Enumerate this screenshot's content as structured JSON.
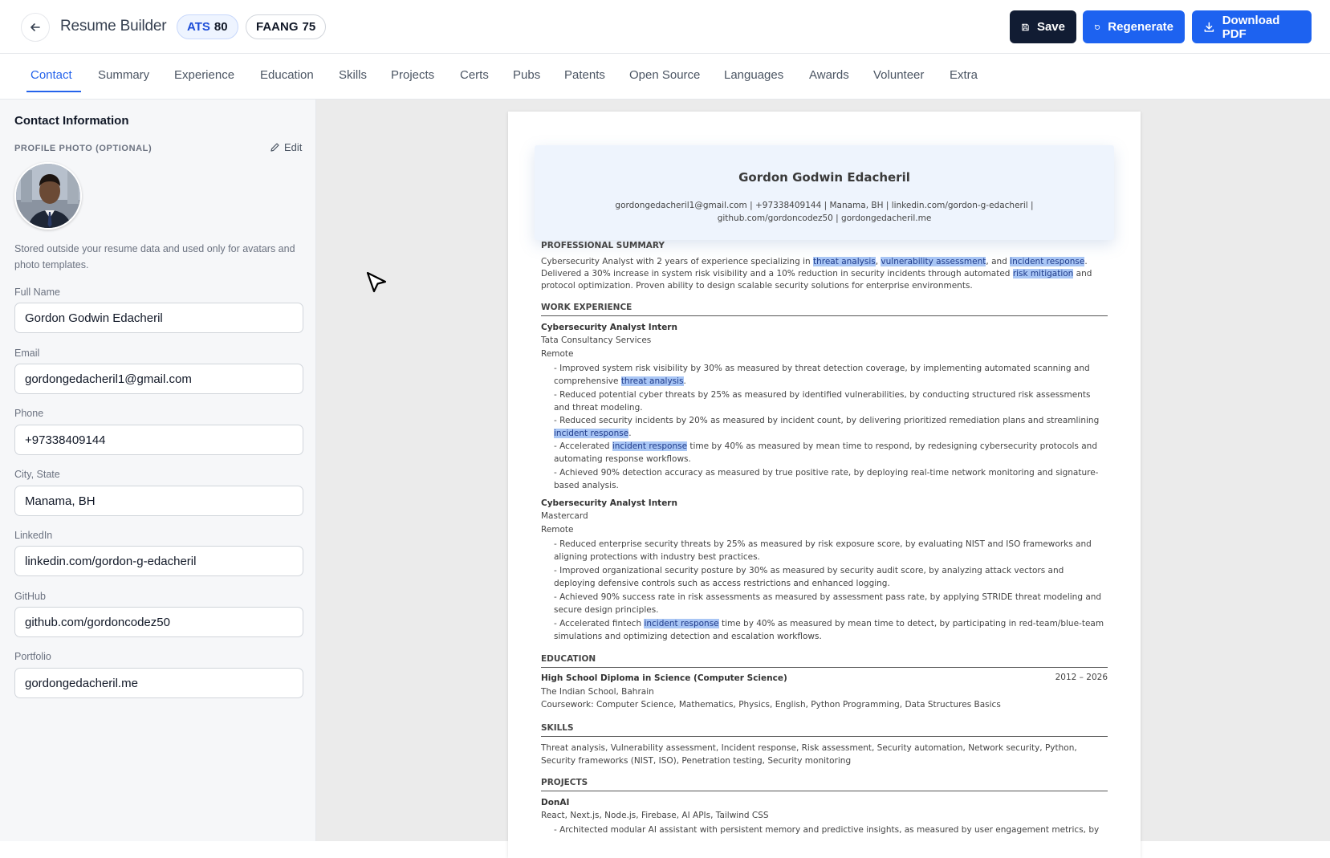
{
  "header": {
    "title": "Resume Builder",
    "ats_label": "ATS",
    "ats_score": "80",
    "faang_label": "FAANG",
    "faang_score": "75",
    "save_label": "Save",
    "regenerate_label": "Regenerate",
    "download_label": "Download PDF"
  },
  "tabs": [
    "Contact",
    "Summary",
    "Experience",
    "Education",
    "Skills",
    "Projects",
    "Certs",
    "Pubs",
    "Patents",
    "Open Source",
    "Languages",
    "Awards",
    "Volunteer",
    "Extra"
  ],
  "active_tab": "Contact",
  "form": {
    "heading": "Contact Information",
    "photo_label": "PROFILE PHOTO (OPTIONAL)",
    "edit_label": "Edit",
    "photo_note": "Stored outside your resume data and used only for avatars and photo templates.",
    "fields": [
      {
        "label": "Full Name",
        "value": "Gordon Godwin Edacheril"
      },
      {
        "label": "Email",
        "value": "gordongedacheril1@gmail.com"
      },
      {
        "label": "Phone",
        "value": "+97338409144"
      },
      {
        "label": "City, State",
        "value": "Manama, BH"
      },
      {
        "label": "LinkedIn",
        "value": "linkedin.com/gordon-g-edacheril"
      },
      {
        "label": "GitHub",
        "value": "github.com/gordoncodez50"
      },
      {
        "label": "Portfolio",
        "value": "gordongedacheril.me"
      }
    ]
  },
  "resume": {
    "name": "Gordon Godwin Edacheril",
    "contact_line": "gordongedacheril1@gmail.com | +97338409144 | Manama, BH | linkedin.com/gordon-g-edacheril | github.com/gordoncodez50 | gordongedacheril.me",
    "summary_heading": "PROFESSIONAL SUMMARY",
    "summary_parts": [
      {
        "t": "Cybersecurity Analyst with 2 years of experience specializing in "
      },
      {
        "t": "threat analysis",
        "hl": true
      },
      {
        "t": ", "
      },
      {
        "t": "vulnerability assessment",
        "hl": true
      },
      {
        "t": ", and "
      },
      {
        "t": "incident response",
        "hl": true
      },
      {
        "t": ". Delivered a 30% increase in system risk visibility and a 10% reduction in security incidents through automated "
      },
      {
        "t": "risk mitigation",
        "hl": true
      },
      {
        "t": " and protocol optimization. Proven ability to design scalable security solutions for enterprise environments."
      }
    ],
    "experience_heading": "WORK EXPERIENCE",
    "jobs": [
      {
        "title": "Cybersecurity Analyst Intern",
        "company": "Tata Consultancy Services",
        "location": "Remote",
        "bullets": [
          [
            {
              "t": "- Improved system risk visibility by 30% as measured by threat detection coverage, by implementing automated scanning and comprehensive "
            },
            {
              "t": "threat analysis",
              "hl": true
            },
            {
              "t": "."
            }
          ],
          [
            {
              "t": "- Reduced potential cyber threats by 25% as measured by identified vulnerabilities, by conducting structured risk assessments and threat modeling."
            }
          ],
          [
            {
              "t": "- Reduced security incidents by 20% as measured by incident count, by delivering prioritized remediation plans and streamlining "
            },
            {
              "t": "incident response",
              "hl": true
            },
            {
              "t": "."
            }
          ],
          [
            {
              "t": "- Accelerated "
            },
            {
              "t": "incident response",
              "hl": true
            },
            {
              "t": " time by 40% as measured by mean time to respond, by redesigning cybersecurity protocols and automating response workflows."
            }
          ],
          [
            {
              "t": "- Achieved 90% detection accuracy as measured by true positive rate, by deploying real-time network monitoring and signature-based analysis."
            }
          ]
        ]
      },
      {
        "title": "Cybersecurity Analyst Intern",
        "company": "Mastercard",
        "location": "Remote",
        "bullets": [
          [
            {
              "t": "- Reduced enterprise security threats by 25% as measured by risk exposure score, by evaluating NIST and ISO frameworks and aligning protections with industry best practices."
            }
          ],
          [
            {
              "t": "- Improved organizational security posture by 30% as measured by security audit score, by analyzing attack vectors and deploying defensive controls such as access restrictions and enhanced logging."
            }
          ],
          [
            {
              "t": "- Achieved 90% success rate in risk assessments as measured by assessment pass rate, by applying STRIDE threat modeling and secure design principles."
            }
          ],
          [
            {
              "t": "- Accelerated fintech "
            },
            {
              "t": "incident response",
              "hl": true
            },
            {
              "t": " time by 40% as measured by mean time to detect, by participating in red-team/blue-team simulations and optimizing detection and escalation workflows."
            }
          ]
        ]
      }
    ],
    "education_heading": "EDUCATION",
    "education": {
      "degree": "High School Diploma in Science (Computer Science)",
      "years": "2012 – 2026",
      "school": "The Indian School, Bahrain",
      "coursework": "Coursework: Computer Science, Mathematics, Physics, English, Python Programming, Data Structures Basics"
    },
    "skills_heading": "SKILLS",
    "skills": "Threat analysis, Vulnerability assessment, Incident response, Risk assessment, Security automation, Network security, Python, Security frameworks (NIST, ISO), Penetration testing, Security monitoring",
    "projects_heading": "PROJECTS",
    "project": {
      "name": "DonAI",
      "stack": "React, Next.js, Node.js, Firebase, AI APIs, Tailwind CSS",
      "bullet": "- Architected modular AI assistant with persistent memory and predictive insights, as measured by user engagement metrics, by"
    }
  }
}
